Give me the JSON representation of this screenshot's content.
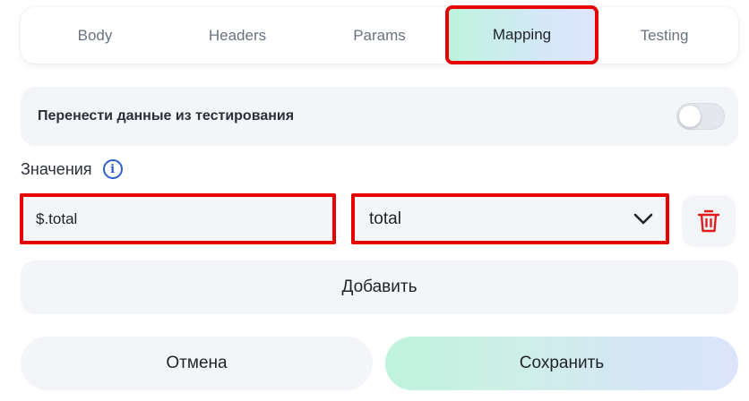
{
  "tabs": [
    {
      "label": "Body"
    },
    {
      "label": "Headers"
    },
    {
      "label": "Params"
    },
    {
      "label": "Mapping",
      "active": true
    },
    {
      "label": "Testing"
    }
  ],
  "transfer_toggle": {
    "label": "Перенести данные из тестирования",
    "enabled": false
  },
  "values_section": {
    "label": "Значения",
    "info_icon": "info-icon"
  },
  "mapping": {
    "path_value": "$.total",
    "field_value": "total",
    "delete_icon": "trash-icon"
  },
  "add_button": "Добавить",
  "cancel_button": "Отмена",
  "save_button": "Сохранить",
  "colors": {
    "highlight": "#e60000",
    "delete": "#e11d1d",
    "info": "#2f5fd0",
    "panel_bg": "#f3f5f8"
  }
}
